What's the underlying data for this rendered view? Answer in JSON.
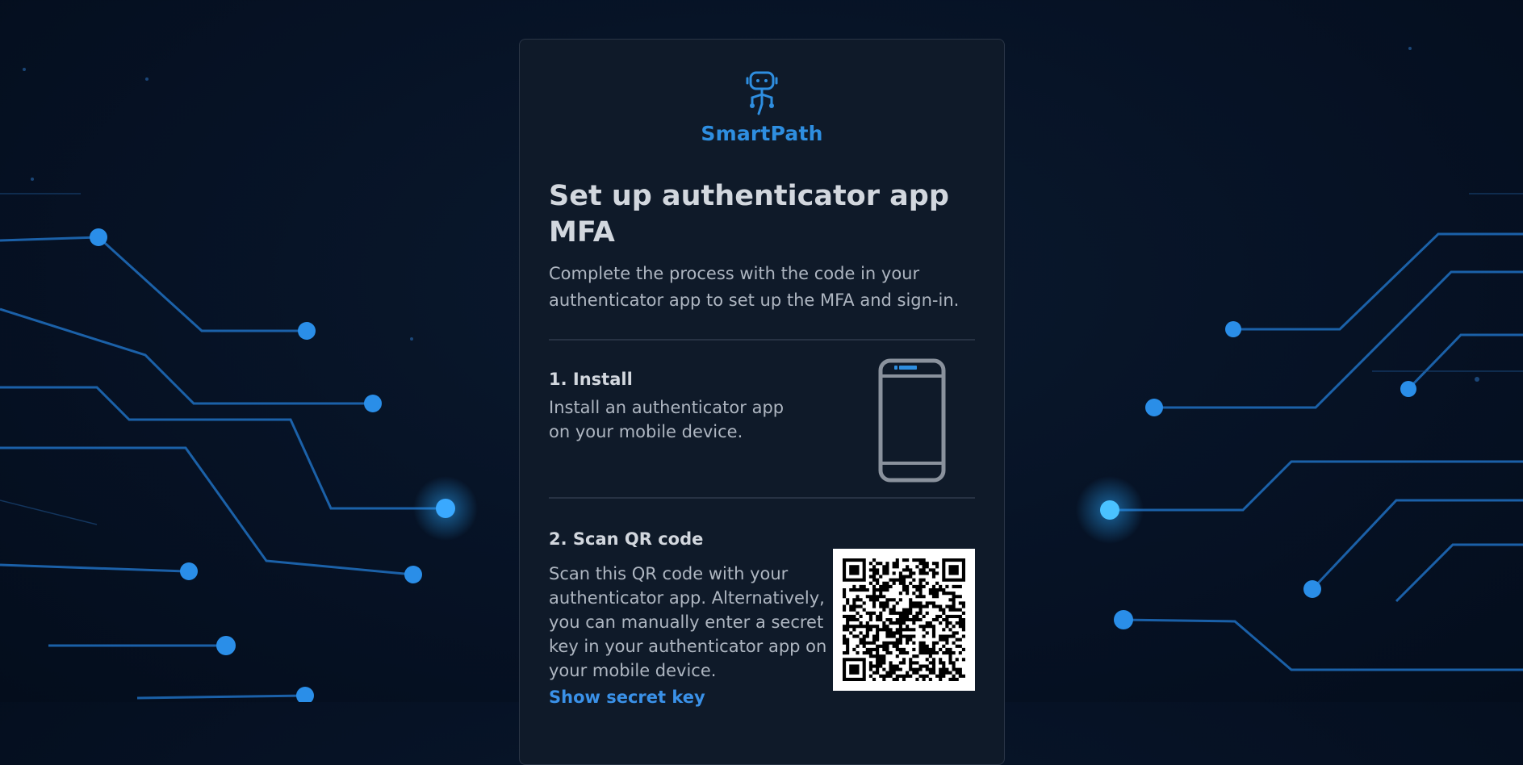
{
  "brand": {
    "name": "SmartPath",
    "accent_color": "#2e8ee0",
    "logo_icon": "robot-icon"
  },
  "page": {
    "title": "Set up authenticator app MFA",
    "description": "Complete the process with the code in your authenticator app to set up the MFA and sign-in."
  },
  "steps": {
    "install": {
      "title": "1. Install",
      "text": "Install an authenticator app on your mobile device.",
      "icon": "mobile-phone-icon"
    },
    "scan": {
      "title": "2. Scan QR code",
      "text": "Scan this QR code with your authenticator app. Alternatively, you can manually enter a secret key in your authenticator app on your mobile device.",
      "link_label": "Show secret key",
      "icon": "qr-code-icon"
    }
  },
  "colors": {
    "background": "#061225",
    "card": "#0f1a29",
    "link": "#3a91e8",
    "circuit": "#1e7fd6"
  }
}
